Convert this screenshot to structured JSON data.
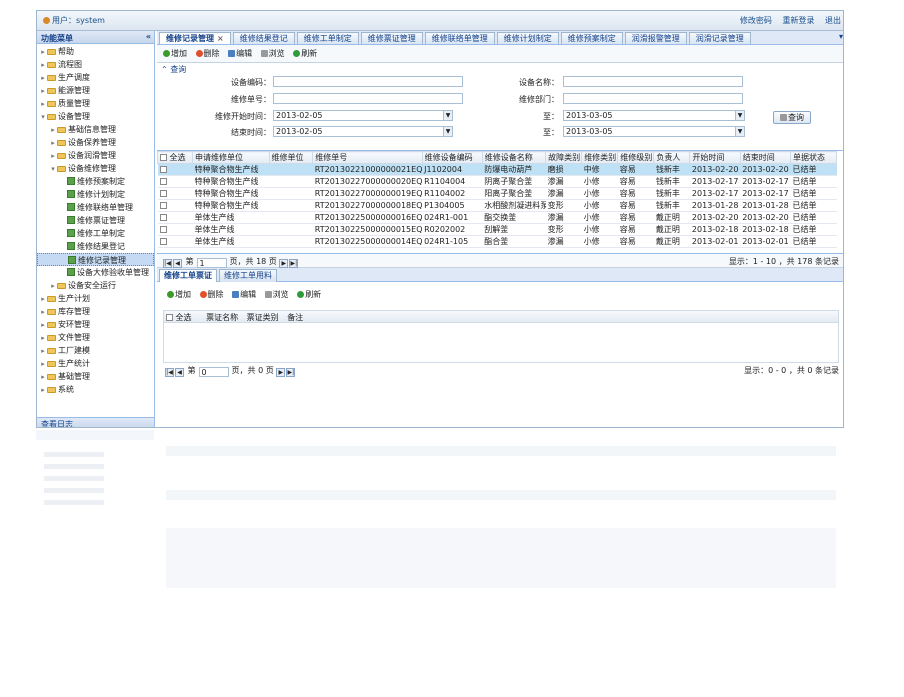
{
  "topbar": {
    "user": "用户：system",
    "links": [
      "修改密码",
      "重新登录",
      "退出"
    ]
  },
  "sidebar": {
    "title": "功能菜单",
    "collapse_icon": "«",
    "items": [
      {
        "label": "帮助",
        "level": 0,
        "expanded": false
      },
      {
        "label": "流程图",
        "level": 0,
        "expanded": false
      },
      {
        "label": "生产调度",
        "level": 0,
        "expanded": false
      },
      {
        "label": "能源管理",
        "level": 0,
        "expanded": false
      },
      {
        "label": "质量管理",
        "level": 0,
        "expanded": false
      },
      {
        "label": "设备管理",
        "level": 0,
        "expanded": true
      },
      {
        "label": "基础信息管理",
        "level": 1,
        "expanded": false
      },
      {
        "label": "设备保养管理",
        "level": 1,
        "expanded": false
      },
      {
        "label": "设备润滑管理",
        "level": 1,
        "expanded": false
      },
      {
        "label": "设备维修管理",
        "level": 1,
        "expanded": true
      },
      {
        "label": "维修预案制定",
        "level": 2,
        "leaf": true
      },
      {
        "label": "维修计划制定",
        "level": 2,
        "leaf": true
      },
      {
        "label": "维修联络单管理",
        "level": 2,
        "leaf": true
      },
      {
        "label": "维修票证管理",
        "level": 2,
        "leaf": true
      },
      {
        "label": "维修工单制定",
        "level": 2,
        "leaf": true
      },
      {
        "label": "维修结果登记",
        "level": 2,
        "leaf": true
      },
      {
        "label": "维修记录管理",
        "level": 2,
        "leaf": true,
        "selected": true
      },
      {
        "label": "设备大修验收单管理",
        "level": 2,
        "leaf": true
      },
      {
        "label": "设备安全运行",
        "level": 1,
        "expanded": false
      },
      {
        "label": "生产计划",
        "level": 0,
        "expanded": false
      },
      {
        "label": "库存管理",
        "level": 0,
        "expanded": false
      },
      {
        "label": "安环管理",
        "level": 0,
        "expanded": false
      },
      {
        "label": "文件管理",
        "level": 0,
        "expanded": false
      },
      {
        "label": "工厂建模",
        "level": 0,
        "expanded": false
      },
      {
        "label": "生产统计",
        "level": 0,
        "expanded": false
      },
      {
        "label": "基础管理",
        "level": 0,
        "expanded": false
      },
      {
        "label": "系统",
        "level": 0,
        "expanded": false
      }
    ],
    "status_tab": "查看日志"
  },
  "tabs": [
    "维修记录管理",
    "维修结果登记",
    "维修工单制定",
    "维修票证管理",
    "维修联络单管理",
    "维修计划制定",
    "维修预案制定",
    "润滑报警管理",
    "润滑记录管理"
  ],
  "tab_close": "×",
  "tab_menu": "▾",
  "toolbar": {
    "add": "增加",
    "delete": "删除",
    "edit": "编辑",
    "view": "浏览",
    "refresh": "刷新"
  },
  "query": {
    "title": "查询",
    "toggle": "⌃",
    "fields": {
      "device_code": {
        "label": "设备编码：",
        "value": ""
      },
      "device_name": {
        "label": "设备名称：",
        "value": ""
      },
      "repair_no": {
        "label": "维修单号：",
        "value": ""
      },
      "repair_dept": {
        "label": "维修部门：",
        "value": ""
      },
      "start_time": {
        "label": "维修开始时间：",
        "from": "2013-02-05",
        "to_label": "至：",
        "to": "2013-03-05"
      },
      "end_time": {
        "label": "结束时间：",
        "from": "2013-02-05",
        "to_label": "至：",
        "to": "2013-03-05"
      }
    },
    "button": "查询"
  },
  "grid": {
    "select_all": "全选",
    "columns": [
      "申请维修单位",
      "维修单位",
      "维修单号",
      "维修设备编码",
      "维修设备名称",
      "故障类别",
      "维修类别",
      "维修级别",
      "负责人",
      "开始时间",
      "结束时间",
      "单据状态"
    ],
    "rows": [
      [
        "特种聚合物生产线",
        "",
        "RT20130221000000021EQ",
        "J1102004",
        "防爆电动葫芦",
        "磨损",
        "中修",
        "容易",
        "钱新丰",
        "2013-02-20",
        "2013-02-20",
        "已结单"
      ],
      [
        "特种聚合物生产线",
        "",
        "RT20130227000000020EQ",
        "R1104004",
        "阴离子聚合釜",
        "渗漏",
        "小修",
        "容易",
        "钱新丰",
        "2013-02-17",
        "2013-02-17",
        "已结单"
      ],
      [
        "特种聚合物生产线",
        "",
        "RT20130227000000019EQ",
        "R1104002",
        "阳离子聚合釜",
        "渗漏",
        "小修",
        "容易",
        "钱新丰",
        "2013-02-17",
        "2013-02-17",
        "已结单"
      ],
      [
        "特种聚合物生产线",
        "",
        "RT20130227000000018EQ",
        "P1304005",
        "水相酸剂凝进料泵",
        "变形",
        "小修",
        "容易",
        "钱新丰",
        "2013-01-28",
        "2013-01-28",
        "已结单"
      ],
      [
        "单体生产线",
        "",
        "RT20130225000000016EQ",
        "024R1-001",
        "酯交换釜",
        "渗漏",
        "小修",
        "容易",
        "戴正明",
        "2013-02-20",
        "2013-02-20",
        "已结单"
      ],
      [
        "单体生产线",
        "",
        "RT20130225000000015EQ",
        "R0202002",
        "刮解釜",
        "变形",
        "小修",
        "容易",
        "戴正明",
        "2013-02-18",
        "2013-02-18",
        "已结单"
      ],
      [
        "单体生产线",
        "",
        "RT20130225000000014EQ",
        "024R1-105",
        "酯合釜",
        "渗漏",
        "小修",
        "容易",
        "戴正明",
        "2013-02-01",
        "2013-02-01",
        "已结单"
      ]
    ],
    "selected_row": 0
  },
  "pager": {
    "page_label": "第",
    "page": "1",
    "of": "页，共 18 页",
    "info": "显示：1 - 10 ，共 178 条记录",
    "first": "|◀",
    "prev": "◀",
    "next": "▶",
    "last": "▶|"
  },
  "subtabs": [
    "维修工单票证",
    "维修工单用料"
  ],
  "subtoolbar": {
    "add": "增加",
    "delete": "删除",
    "edit": "编辑",
    "view": "浏览",
    "refresh": "刷新"
  },
  "subgrid": {
    "select_all": "全选",
    "columns": [
      "票证名称",
      "票证类别",
      "备注"
    ]
  },
  "subpager": {
    "page_label": "第",
    "page": "0",
    "of": "页，共 0 页",
    "info": "显示：0 - 0 ，共 0 条记录"
  },
  "colors": {
    "accent": "#15428b",
    "header_bg": "#dfe8f6",
    "selected_row": "#bfe1f5",
    "border": "#99bbe8"
  }
}
